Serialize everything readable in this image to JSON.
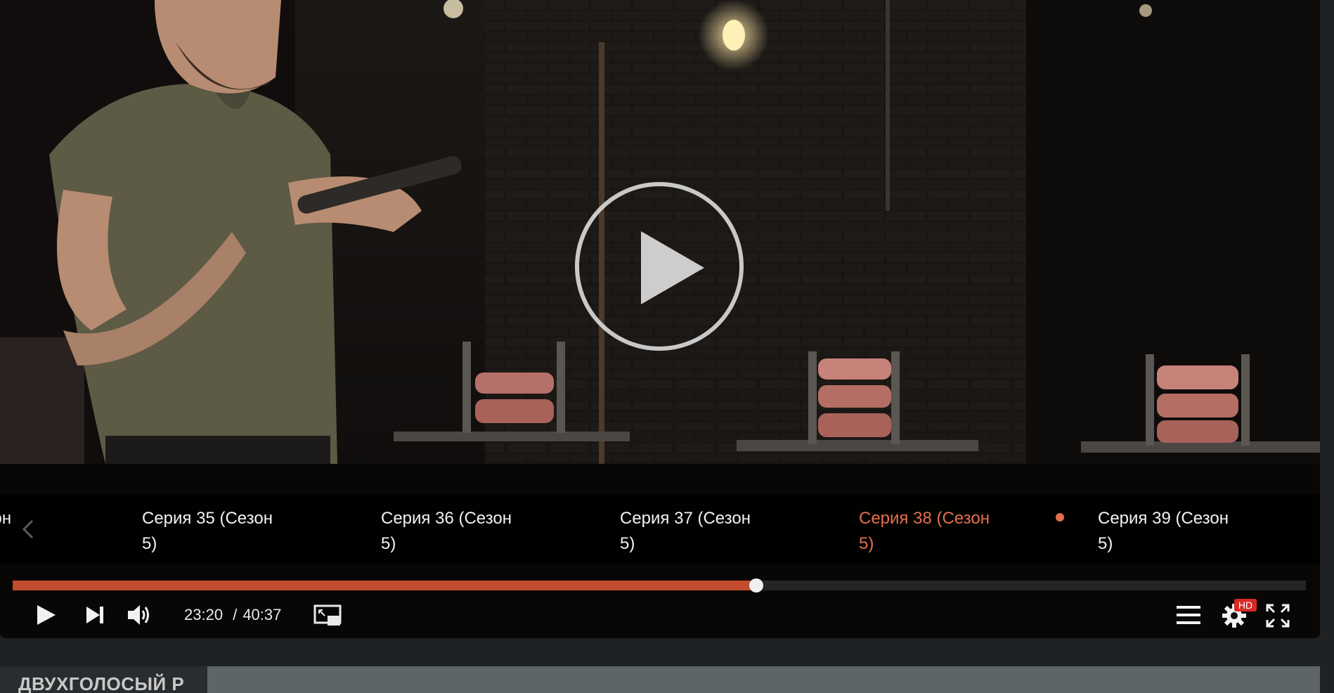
{
  "player": {
    "video_scene": "cooking-show-frame",
    "big_play_icon": "play-circle-icon"
  },
  "episodes": [
    {
      "label": "езон",
      "current": false
    },
    {
      "label": "Серия 35 (Сезон 5)",
      "current": false
    },
    {
      "label": "Серия 36 (Сезон 5)",
      "current": false
    },
    {
      "label": "Серия 37 (Сезон 5)",
      "current": false
    },
    {
      "label": "Серия 38 (Сезон 5)",
      "current": true
    },
    {
      "label": "Серия 39 (Сезон 5)",
      "current": false
    }
  ],
  "progress": {
    "played_fraction": 0.575
  },
  "controls": {
    "current_time": "23:20",
    "separator": "/",
    "duration": "40:37",
    "hd_badge": "HD"
  },
  "colors": {
    "accent": "#c34c2e",
    "current_episode": "#e46f4c",
    "hd_badge": "#d62b25",
    "panel_grey": "#5d6569"
  },
  "bottom": {
    "title": "ДВУХГОЛОСЫЙ Р"
  }
}
